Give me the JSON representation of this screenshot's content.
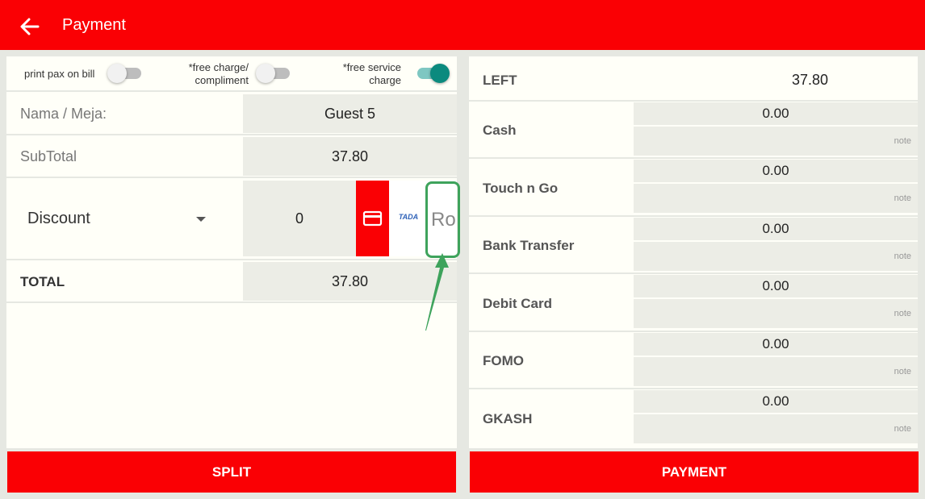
{
  "header": {
    "title": "Payment",
    "back_icon": "arrow-left-icon",
    "color": "#fa0004"
  },
  "toggles": {
    "print_pax": {
      "label": "print pax on bill",
      "on": false
    },
    "free_charge": {
      "label_line1": "*free charge/",
      "label_line2": "compliment",
      "on": false
    },
    "free_service": {
      "label_line1": "*free service",
      "label_line2": "charge",
      "on": true
    }
  },
  "order": {
    "name_label": "Nama / Meja:",
    "name_value": "Guest 5",
    "subtotal_label": "SubTotal",
    "subtotal_value": "37.80",
    "discount_label": "Discount",
    "discount_value": "0",
    "tada_label": "TADA",
    "ro_label": "Ro",
    "total_label": "TOTAL",
    "total_value": "37.80"
  },
  "payment": {
    "left_label": "LEFT",
    "left_value": "37.80",
    "note_placeholder": "note",
    "methods": [
      {
        "name": "Cash",
        "amount": "0.00"
      },
      {
        "name": "Touch n Go",
        "amount": "0.00"
      },
      {
        "name": "Bank Transfer",
        "amount": "0.00"
      },
      {
        "name": "Debit Card",
        "amount": "0.00"
      },
      {
        "name": "FOMO",
        "amount": "0.00"
      },
      {
        "name": "GKASH",
        "amount": "0.00"
      }
    ]
  },
  "actions": {
    "split_label": "SPLIT",
    "payment_label": "PAYMENT"
  },
  "colors": {
    "accent": "#fa0004",
    "toggle_on": "#0b8a7e",
    "highlight": "#3ea35c"
  }
}
